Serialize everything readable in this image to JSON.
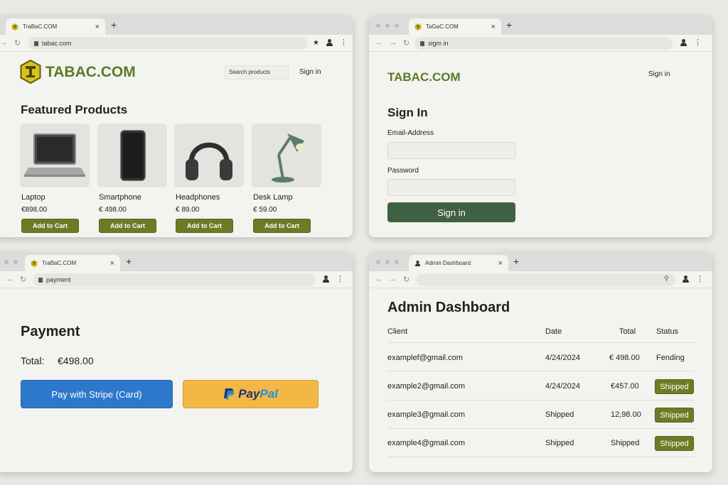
{
  "colors": {
    "brand_olive": "#5a7a25",
    "button_olive": "#6d7c24",
    "signin_green": "#3f6041",
    "stripe_blue": "#2e78cc",
    "paypal_yellow": "#f2b744"
  },
  "shop_window": {
    "tab_title": "TraBaC.COM",
    "url": "tabac.com",
    "brand": "TABAC.COM",
    "search_placeholder": "Search products",
    "signin_label": "Sign in",
    "heading": "Featured Products",
    "products": [
      {
        "name": "Laptop",
        "price": "€898.00",
        "button": "Add to Cart",
        "icon": "laptop-icon"
      },
      {
        "name": "Smartphone",
        "price": "€ 498.00",
        "button": "Add to Cart",
        "icon": "smartphone-icon"
      },
      {
        "name": "Headphones",
        "price": "€ 89.00",
        "button": "Add to Cart",
        "icon": "headphones-icon"
      },
      {
        "name": "Desk Lamp",
        "price": "€ 59.00",
        "button": "Add to Cart",
        "icon": "desk-lamp-icon"
      }
    ]
  },
  "signin_window": {
    "tab_title": "TaGaC.COM",
    "url": "sigm in",
    "brand": "TABAC.COM",
    "signin_link": "Sign in",
    "heading": "Sign In",
    "email_label": "Email-Address",
    "password_label": "Password",
    "submit_label": "Sign in"
  },
  "payment_window": {
    "tab_title": "TraBaC.COM",
    "url": "payment",
    "heading": "Payment",
    "total_label": "Total:",
    "total_value": "€498.00",
    "stripe_label": "Pay with Stripe (Card)",
    "paypal_part1": "Pay",
    "paypal_part2": "Pal"
  },
  "admin_window": {
    "tab_title": "Admin Dashboard",
    "heading": "Admin Dashboard",
    "columns": [
      "Client",
      "Date",
      "Total",
      "Status"
    ],
    "rows": [
      {
        "client": "examplef@gmail.com",
        "date": "4/24/2024",
        "total": "€ 498.00",
        "status": "Fending",
        "status_badge": false
      },
      {
        "client": "example2@gmail.com",
        "date": "4/24/2024",
        "total": "€457.00",
        "status": "Shipped",
        "status_badge": true
      },
      {
        "client": "example3@gmail.com",
        "date": "Shipped",
        "total": "12,98.00",
        "status": "Shipped",
        "status_badge": true
      },
      {
        "client": "example4@gmail.com",
        "date": "Shipped",
        "total": "Shipped",
        "status": "Shipped",
        "status_badge": true
      }
    ]
  }
}
